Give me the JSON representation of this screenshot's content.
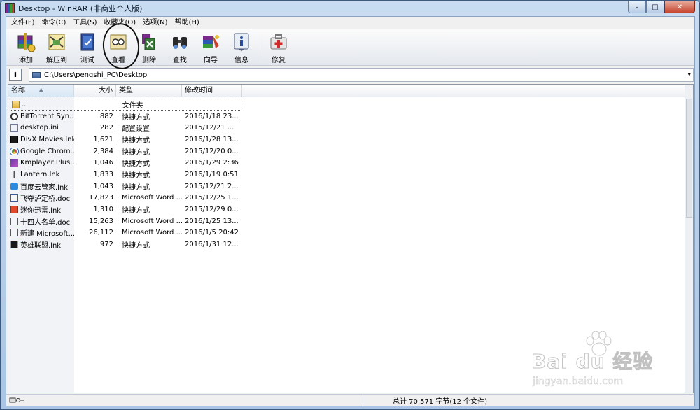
{
  "window": {
    "title": "Desktop - WinRAR (非商业个人版)",
    "buttons": [
      "–",
      "□",
      "✕"
    ]
  },
  "menu": [
    "文件(F)",
    "命令(C)",
    "工具(S)",
    "收藏夹(O)",
    "选项(N)",
    "帮助(H)"
  ],
  "toolbar": [
    {
      "label": "添加",
      "icon": "add-archive-icon"
    },
    {
      "label": "解压到",
      "icon": "extract-icon"
    },
    {
      "label": "测试",
      "icon": "test-icon"
    },
    {
      "label": "查看",
      "icon": "view-icon"
    },
    {
      "label": "删除",
      "icon": "delete-icon"
    },
    {
      "label": "查找",
      "icon": "find-icon"
    },
    {
      "label": "向导",
      "icon": "wizard-icon"
    },
    {
      "label": "信息",
      "icon": "info-icon"
    },
    {
      "label": "修复",
      "icon": "repair-icon"
    }
  ],
  "address": {
    "path": "C:\\Users\\pengshi_PC\\Desktop",
    "dropdown": "▾",
    "up": "⬆"
  },
  "columns": {
    "name": "名称",
    "size": "大小",
    "type": "类型",
    "modified": "修改时间"
  },
  "files": [
    {
      "name": "..",
      "size": "",
      "type": "文件夹",
      "modified": "",
      "icon": "folder-icon"
    },
    {
      "name": "BitTorrent Syn...",
      "size": "882",
      "type": "快捷方式",
      "modified": "2016/1/18 23...",
      "icon": "bittorrent-icon"
    },
    {
      "name": "desktop.ini",
      "size": "282",
      "type": "配置设置",
      "modified": "2015/12/21 ...",
      "icon": "ini-file-icon"
    },
    {
      "name": "DivX Movies.lnk",
      "size": "1,621",
      "type": "快捷方式",
      "modified": "2016/1/28 13...",
      "icon": "divx-icon"
    },
    {
      "name": "Google Chrom...",
      "size": "2,384",
      "type": "快捷方式",
      "modified": "2015/12/20 0...",
      "icon": "chrome-icon"
    },
    {
      "name": "Kmplayer Plus...",
      "size": "1,046",
      "type": "快捷方式",
      "modified": "2016/1/29 2:36",
      "icon": "kmplayer-icon"
    },
    {
      "name": "Lantern.lnk",
      "size": "1,833",
      "type": "快捷方式",
      "modified": "2016/1/19 0:51",
      "icon": "lantern-icon"
    },
    {
      "name": "百度云管家.lnk",
      "size": "1,043",
      "type": "快捷方式",
      "modified": "2015/12/21 2...",
      "icon": "baidu-cloud-icon"
    },
    {
      "name": "飞夺泸定桥.doc",
      "size": "17,823",
      "type": "Microsoft Word ...",
      "modified": "2015/12/25 1...",
      "icon": "word-doc-icon"
    },
    {
      "name": "迷你迅雷.lnk",
      "size": "1,310",
      "type": "快捷方式",
      "modified": "2015/12/29 0...",
      "icon": "xunlei-icon"
    },
    {
      "name": "十四人名单.doc",
      "size": "15,263",
      "type": "Microsoft Word ...",
      "modified": "2016/1/25 13...",
      "icon": "word-doc-icon"
    },
    {
      "name": "新建 Microsoft...",
      "size": "26,112",
      "type": "Microsoft Word ...",
      "modified": "2016/1/5 20:42",
      "icon": "word-doc-icon"
    },
    {
      "name": "英雄联盟.lnk",
      "size": "972",
      "type": "快捷方式",
      "modified": "2016/1/31 12...",
      "icon": "lol-icon"
    }
  ],
  "status": {
    "total": "总计 70,571 字节(12 个文件)"
  },
  "watermark": {
    "logo": "Bai du 经验",
    "url": "jingyan.baidu.com"
  },
  "colors": {
    "title_bar": "#b9d1ea",
    "close_button": "#c5452e",
    "annotation_circle": "#111111"
  }
}
